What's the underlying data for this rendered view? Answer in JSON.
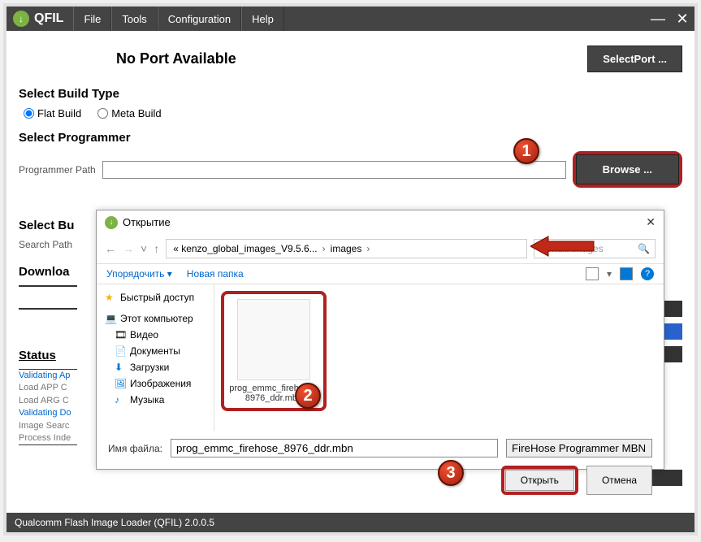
{
  "app": {
    "title": "QFIL",
    "statusbar": "Qualcomm Flash Image Loader (QFIL)   2.0.0.5"
  },
  "menu": {
    "file": "File",
    "tools": "Tools",
    "config": "Configuration",
    "help": "Help"
  },
  "header": {
    "port_status": "No Port Available",
    "select_port": "SelectPort ..."
  },
  "build": {
    "title": "Select Build Type",
    "flat": "Flat Build",
    "meta": "Meta Build"
  },
  "programmer": {
    "title": "Select Programmer",
    "path_label": "Programmer Path",
    "browse": "Browse ..."
  },
  "select_bu": {
    "title": "Select Bu",
    "search": "Search Path"
  },
  "download": {
    "title": "Downloa"
  },
  "status": {
    "title": "Status",
    "l1": "Validating Ap",
    "l2": "Load APP C",
    "l3": "Load ARG C",
    "l4": "Validating Do",
    "l5": "Image Searc",
    "l6": "Process Inde"
  },
  "dialog": {
    "title": "Открытие",
    "path_prefix": "« kenzo_global_images_V9.5.6...",
    "path_leaf": "images",
    "search_placeholder": "Поиск: images",
    "organize": "Упорядочить",
    "newfolder": "Новая папка",
    "sidebar": {
      "quick": "Быстрый доступ",
      "pc": "Этот компьютер",
      "video": "Видео",
      "docs": "Документы",
      "dl": "Загрузки",
      "img": "Изображения",
      "music": "Музыка"
    },
    "file": "prog_emmc_firehose_8976_ddr.mbn",
    "fname_label": "Имя файла:",
    "fname_value": "prog_emmc_firehose_8976_ddr.mbn",
    "filter": "FireHose Programmer MBN (*fi",
    "open": "Открыть",
    "cancel": "Отмена"
  },
  "badges": {
    "b1": "1",
    "b2": "2",
    "b3": "3"
  }
}
